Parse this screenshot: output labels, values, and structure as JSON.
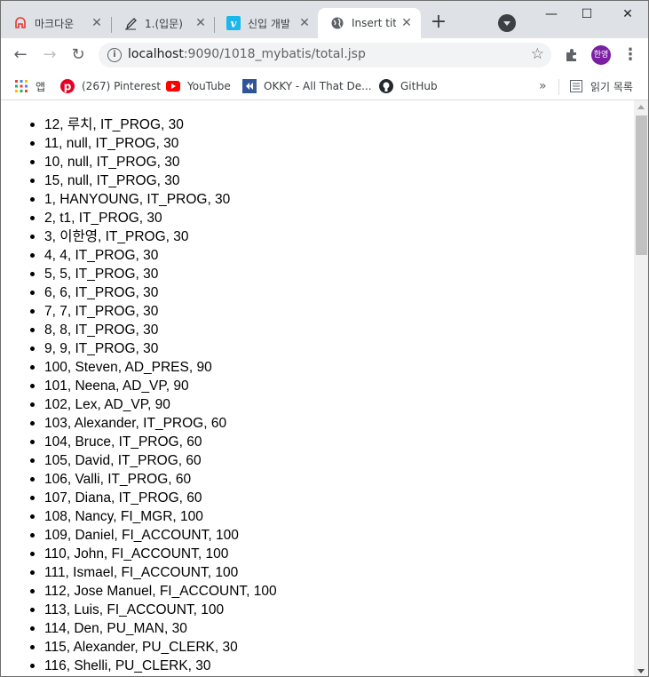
{
  "tabs": [
    {
      "title": "마크다운 ",
      "icon": "markdown-icon",
      "active": false
    },
    {
      "title": "1.(입문) ",
      "icon": "pen-icon",
      "active": false
    },
    {
      "title": "신입 개발",
      "icon": "vimeo-icon",
      "active": false
    },
    {
      "title": "Insert titl",
      "icon": "globe-icon",
      "active": true
    }
  ],
  "toolbar": {
    "url_host": "localhost",
    "url_rest": ":9090/1018_mybatis/total.jsp",
    "avatar_text": "한영"
  },
  "bookmarks": [
    {
      "label": "앱",
      "icon": "apps-grid-icon"
    },
    {
      "label": "(267) Pinterest",
      "icon": "pinterest-icon"
    },
    {
      "label": "YouTube",
      "icon": "youtube-icon"
    },
    {
      "label": "OKKY - All That De...",
      "icon": "okky-icon"
    },
    {
      "label": "GitHub",
      "icon": "github-icon"
    }
  ],
  "reading_list": "읽기 목록",
  "rows": [
    "12, 루치, IT_PROG, 30",
    "11, null, IT_PROG, 30",
    "10, null, IT_PROG, 30",
    "15, null, IT_PROG, 30",
    "1, HANYOUNG, IT_PROG, 30",
    "2, t1, IT_PROG, 30",
    "3, 이한영, IT_PROG, 30",
    "4, 4, IT_PROG, 30",
    "5, 5, IT_PROG, 30",
    "6, 6, IT_PROG, 30",
    "7, 7, IT_PROG, 30",
    "8, 8, IT_PROG, 30",
    "9, 9, IT_PROG, 30",
    "100, Steven, AD_PRES, 90",
    "101, Neena, AD_VP, 90",
    "102, Lex, AD_VP, 90",
    "103, Alexander, IT_PROG, 60",
    "104, Bruce, IT_PROG, 60",
    "105, David, IT_PROG, 60",
    "106, Valli, IT_PROG, 60",
    "107, Diana, IT_PROG, 60",
    "108, Nancy, FI_MGR, 100",
    "109, Daniel, FI_ACCOUNT, 100",
    "110, John, FI_ACCOUNT, 100",
    "111, Ismael, FI_ACCOUNT, 100",
    "112, Jose Manuel, FI_ACCOUNT, 100",
    "113, Luis, FI_ACCOUNT, 100",
    "114, Den, PU_MAN, 30",
    "115, Alexander, PU_CLERK, 30",
    "116, Shelli, PU_CLERK, 30"
  ],
  "colors": {
    "tabstrip": "#dee1e6",
    "pinterest": "#e60023",
    "youtube": "#ff0000",
    "vimeo": "#1ab7ea",
    "avatar": "#7b1fa2"
  }
}
